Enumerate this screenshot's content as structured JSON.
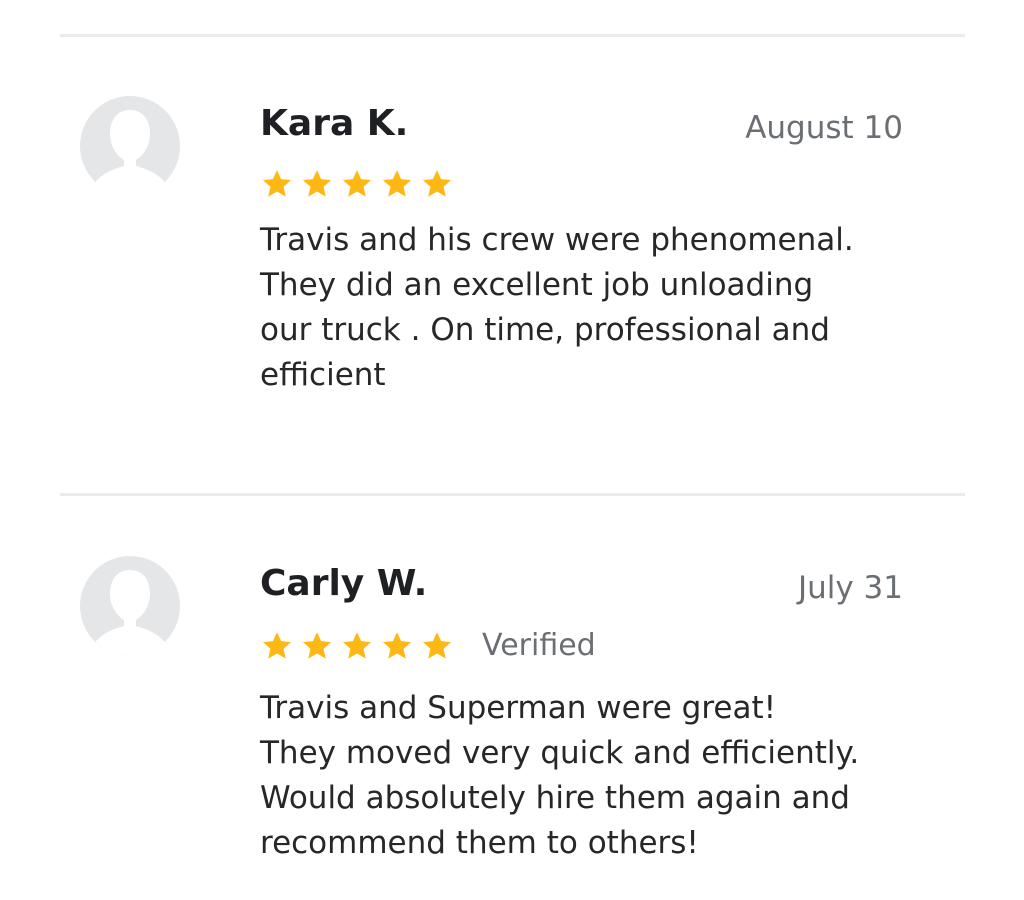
{
  "colors": {
    "star": "#FDB813",
    "avatar": "#E4E6E7",
    "divider": "#E9EBEC",
    "name": "#1F2023",
    "secondary_text": "#6B6F74"
  },
  "reviews": [
    {
      "reviewer_name": "Kara K.",
      "date": "August 10",
      "rating": 5,
      "verified_label": "",
      "avatar_icon": "default-user-avatar-icon",
      "text": "Travis and his crew were phenomenal.\nThey did an excellent job unloading\nour truck . On time, professional and\nefficient"
    },
    {
      "reviewer_name": "Carly W.",
      "date": "July 31",
      "rating": 5,
      "verified_label": "Verified",
      "avatar_icon": "default-user-avatar-icon",
      "text": "Travis and Superman were great!\nThey moved very quick and efficiently.\nWould absolutely hire them again and\nrecommend them to others!"
    }
  ]
}
